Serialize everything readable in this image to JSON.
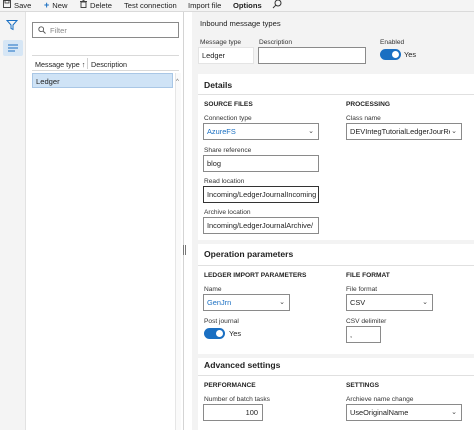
{
  "toolbar": {
    "save": "Save",
    "new": "New",
    "delete": "Delete",
    "test_connection": "Test connection",
    "import_file": "Import file",
    "options": "Options"
  },
  "list": {
    "filter_placeholder": "Filter",
    "col_message_type": "Message type",
    "col_description": "Description",
    "sort_indicator": "↑",
    "selected_row": "Ledger"
  },
  "header": {
    "title": "Inbound message types",
    "message_type_label": "Message type",
    "message_type_value": "Ledger",
    "description_label": "Description",
    "description_value": "",
    "enabled_label": "Enabled",
    "enabled_value": "Yes",
    "enabled_on": true
  },
  "details": {
    "title": "Details",
    "source_files": {
      "heading": "SOURCE FILES",
      "connection_type_label": "Connection type",
      "connection_type_value": "AzureFS",
      "share_reference_label": "Share reference",
      "share_reference_value": "blog",
      "read_location_label": "Read location",
      "read_location_value": "Incoming/LedgerJournalIncoming",
      "archive_location_label": "Archive location",
      "archive_location_value": "Incoming/LedgerJournalArchive/"
    },
    "processing": {
      "heading": "PROCESSING",
      "class_name_label": "Class name",
      "class_name_value": "DEVIntegTutorialLedgerJourRec"
    }
  },
  "operation": {
    "title": "Operation parameters",
    "ledger_import": {
      "heading": "LEDGER IMPORT PARAMETERS",
      "name_label": "Name",
      "name_value": "GenJrn",
      "post_journal_label": "Post journal",
      "post_journal_value": "Yes",
      "post_journal_on": true
    },
    "file_format": {
      "heading": "FILE FORMAT",
      "file_format_label": "File format",
      "file_format_value": "CSV",
      "csv_delimiter_label": "CSV delimiter",
      "csv_delimiter_value": ","
    }
  },
  "advanced": {
    "title": "Advanced settings",
    "performance": {
      "heading": "PERFORMANCE",
      "batch_tasks_label": "Number of batch tasks",
      "batch_tasks_value": "100"
    },
    "settings": {
      "heading": "SETTINGS",
      "archive_name_change_label": "Archieve name change",
      "archive_name_change_value": "UseOriginalName"
    }
  },
  "colors": {
    "accent": "#1a6fc2",
    "selection": "#cfe3f6",
    "panel_bg": "#f3f3f3"
  },
  "icons": {
    "save": "save-icon",
    "new": "plus-icon",
    "delete": "trash-icon",
    "search": "search-icon",
    "filter": "filter-icon",
    "list": "list-icon"
  }
}
